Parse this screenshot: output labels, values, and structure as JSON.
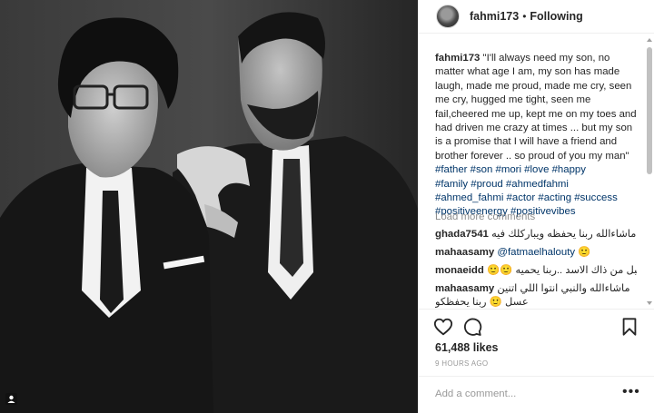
{
  "post": {
    "username": "fahmi173",
    "separator": "•",
    "follow_status": "Following",
    "caption_author": "fahmi173",
    "caption_text": " \"I'll always need my son, no matter what age I am, my son has made laugh, made me proud, made me cry, seen me cry, hugged me tight, seen me fail,cheered me up, kept me on my toes and had driven me crazy at times ... but my son is a promise that I will have a friend and brother forever .. so proud of you my man\" ",
    "hashtags": [
      "#father",
      "#son",
      "#mori",
      "#love",
      "#happy",
      "#family",
      "#proud",
      "#ahmedfahmi",
      "#ahmed_fahmi",
      "#actor",
      "#acting",
      "#success",
      "#positiveenergy",
      "#positivevibes"
    ],
    "load_more": "Load more comments",
    "comments": [
      {
        "user": "ghada7541",
        "text": "ماشاءالله ربنا يحفظه ويباركلك فيه"
      },
      {
        "user": "mahaasamy",
        "text": "@fatmaelhalouty 🙂"
      },
      {
        "user": "monaeidd",
        "text": "هذا الشبل من ذاك الاسد ..ربنا يحميه 🙂🙂"
      },
      {
        "user": "mahaasamy",
        "text": "ماشاءالله والنبي انتوا اللي اتنين عسل 🙂 ربنا يحفظكو"
      }
    ],
    "likes": "61,488 likes",
    "time": "9 HOURS AGO",
    "add_comment_placeholder": "Add a comment...",
    "more_label": "•••"
  },
  "icons": {
    "like": "heart-icon",
    "comment": "speech-bubble-icon",
    "save": "bookmark-icon",
    "badge": "video-indicator-icon"
  },
  "colors": {
    "link": "#003569",
    "muted": "#8e8e8e",
    "text": "#262626",
    "border": "#efefef"
  }
}
